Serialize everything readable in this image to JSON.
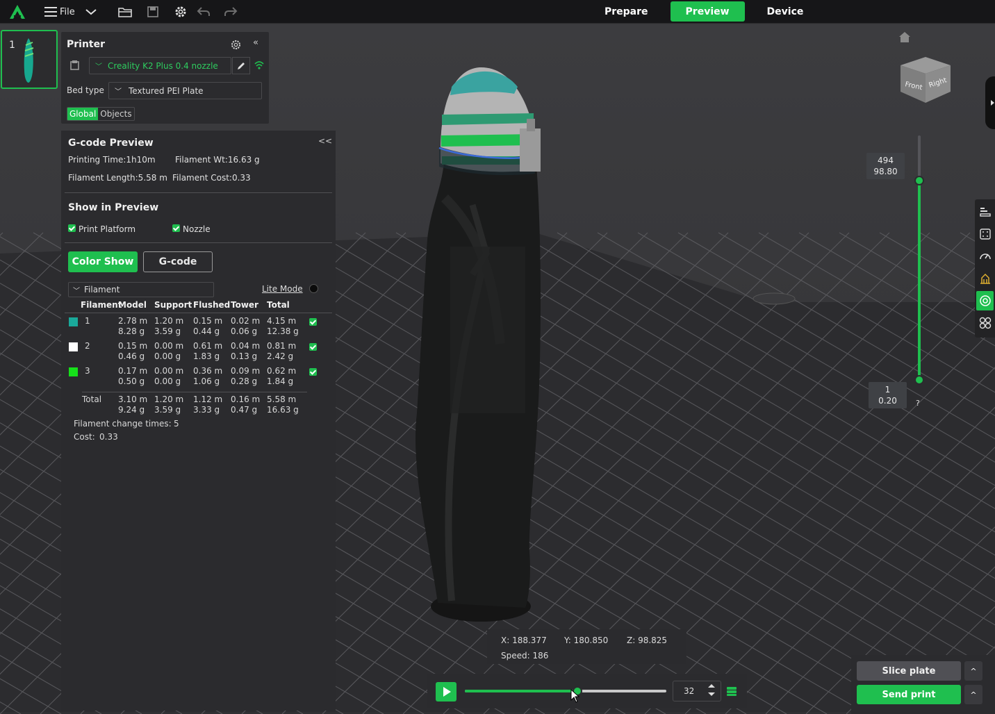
{
  "topbar": {
    "file_label": "File",
    "tabs": [
      {
        "label": "Prepare",
        "active": false
      },
      {
        "label": "Preview",
        "active": true
      },
      {
        "label": "Device",
        "active": false
      }
    ],
    "accent_color": "#1fbf4f"
  },
  "plate": {
    "number": "1"
  },
  "printer": {
    "title": "Printer",
    "printer_name": "Creality K2 Plus 0.4 nozzle",
    "bed_type_label": "Bed type",
    "bed_type_value": "Textured PEI Plate",
    "scope": [
      "Global",
      "Objects"
    ]
  },
  "gcode": {
    "title": "G-code Preview",
    "printing_time": "Printing Time:1h10m",
    "filament_wt": "Filament Wt:16.63 g",
    "filament_length": "Filament Length:5.58 m",
    "filament_cost": "Filament Cost:0.33",
    "show_title": "Show in Preview",
    "show_platform": "Print Platform",
    "show_nozzle": "Nozzle",
    "btn_color_show": "Color Show",
    "btn_gcode": "G-code",
    "view_select": "Filament",
    "lite_mode": "Lite Mode",
    "headers": [
      "Filament",
      "Model",
      "Support",
      "Flushed",
      "Tower",
      "Total"
    ],
    "rows": [
      {
        "id": "1",
        "color": "#1aa99a",
        "model_m": "2.78 m",
        "model_g": "8.28 g",
        "support_m": "1.20 m",
        "support_g": "3.59 g",
        "flushed_m": "0.15 m",
        "flushed_g": "0.44 g",
        "tower_m": "0.02 m",
        "tower_g": "0.06 g",
        "total_m": "4.15 m",
        "total_g": "12.38 g"
      },
      {
        "id": "2",
        "color": "#ffffff",
        "model_m": "0.15 m",
        "model_g": "0.46 g",
        "support_m": "0.00 m",
        "support_g": "0.00 g",
        "flushed_m": "0.61 m",
        "flushed_g": "1.83 g",
        "tower_m": "0.04 m",
        "tower_g": "0.13 g",
        "total_m": "0.81 m",
        "total_g": "2.42 g"
      },
      {
        "id": "3",
        "color": "#16e01a",
        "model_m": "0.17 m",
        "model_g": "0.50 g",
        "support_m": "0.00 m",
        "support_g": "0.00 g",
        "flushed_m": "0.36 m",
        "flushed_g": "1.06 g",
        "tower_m": "0.09 m",
        "tower_g": "0.28 g",
        "total_m": "0.62 m",
        "total_g": "1.84 g"
      }
    ],
    "total": {
      "label": "Total",
      "model_m": "3.10 m",
      "model_g": "9.24 g",
      "support_m": "1.20 m",
      "support_g": "3.59 g",
      "flushed_m": "1.12 m",
      "flushed_g": "3.33 g",
      "tower_m": "0.16 m",
      "tower_g": "0.47 g",
      "total_m": "5.58 m",
      "total_g": "16.63 g"
    },
    "change_label": "Filament change times:",
    "change_value": "5",
    "cost_label": "Cost:",
    "cost_value": "0.33"
  },
  "navcube": {
    "front": "Front",
    "right": "Right"
  },
  "layer_slider": {
    "top_layer": "494",
    "top_height": "98.80",
    "bottom_layer": "1",
    "bottom_height": "0.20",
    "help": "?"
  },
  "coords": {
    "x": "X: 188.377",
    "y": "Y: 180.850",
    "z": "Z: 98.825",
    "speed": "Speed: 186"
  },
  "playback": {
    "move_value": "32",
    "progress": 0.56
  },
  "actions": {
    "slice": "Slice plate",
    "send": "Send print",
    "caret": "^"
  }
}
